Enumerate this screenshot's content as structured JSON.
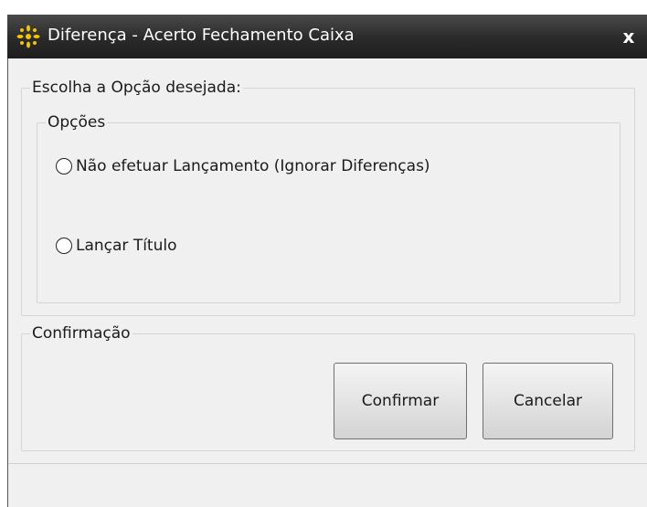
{
  "window": {
    "title": "Diferença - Acerto Fechamento Caixa",
    "close_label": "x",
    "icon": "sparkle-app-icon",
    "title_bar_color": "#2b2b2b",
    "icon_color": "#f2c500"
  },
  "main_group": {
    "legend": "Escolha a Opção desejada:",
    "options_group": {
      "legend": "Opções",
      "radios": [
        {
          "label": "Não efetuar Lançamento (Ignorar Diferenças)",
          "checked": false
        },
        {
          "label": "Lançar Título",
          "checked": false
        }
      ]
    }
  },
  "confirm_group": {
    "legend": "Confirmação",
    "confirm_label": "Confirmar",
    "cancel_label": "Cancelar"
  }
}
